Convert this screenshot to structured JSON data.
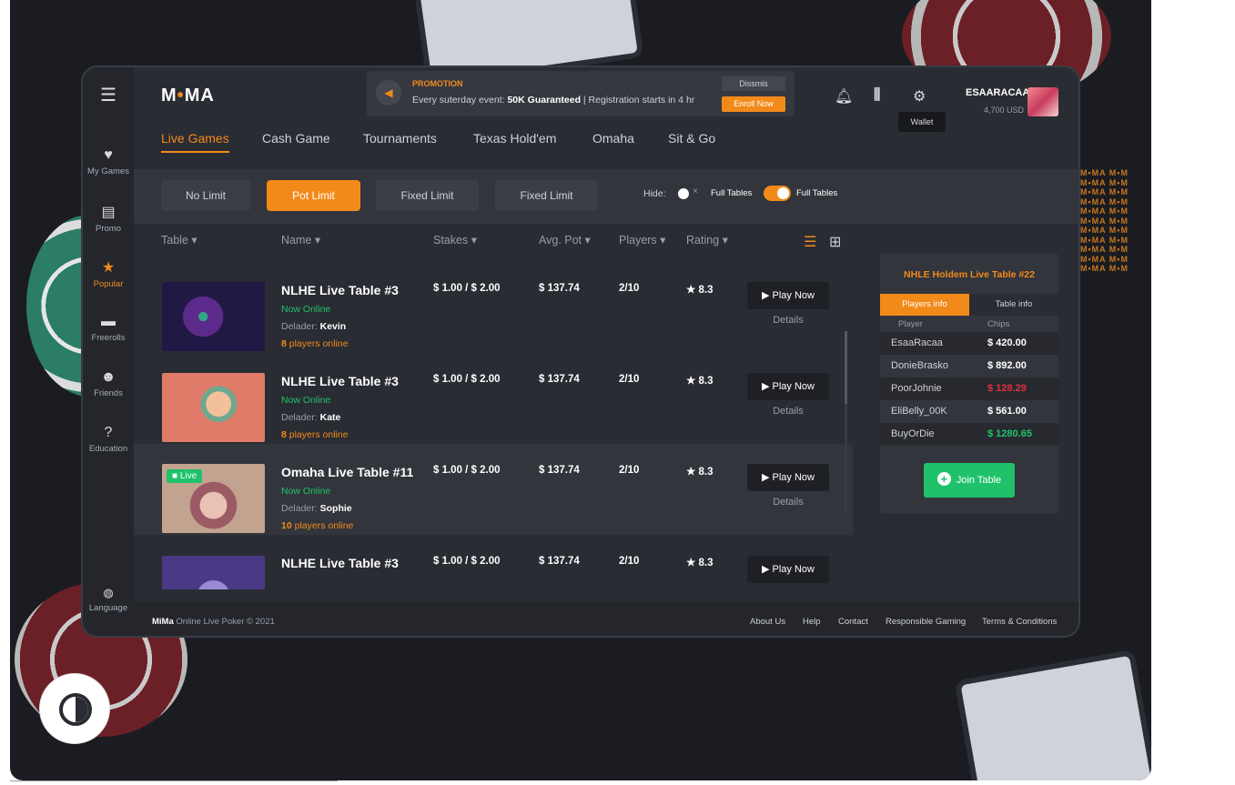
{
  "sidebar": {
    "items": [
      {
        "label": "My Games",
        "icon": "heart-icon",
        "glyph": "♥"
      },
      {
        "label": "Promo",
        "icon": "news-icon",
        "glyph": "▤"
      },
      {
        "label": "Popular",
        "icon": "star-icon",
        "glyph": "★"
      },
      {
        "label": "Freerolls",
        "icon": "briefcase-icon",
        "glyph": "▬"
      },
      {
        "label": "Friends",
        "icon": "friends-icon",
        "glyph": "☻"
      },
      {
        "label": "Education",
        "icon": "question-icon",
        "glyph": "?"
      },
      {
        "label": "Language",
        "icon": "globe-icon",
        "glyph": "◍"
      }
    ]
  },
  "header": {
    "logo_left": "M",
    "logo_dot": "•",
    "logo_right": "MA",
    "promo_title": "PROMOTION",
    "promo_text_pre": "Every suterday event: ",
    "promo_text_bold": "50K Guaranteed",
    "promo_text_post": " | Registration starts in 4 hr",
    "dismiss": "Dissmis",
    "enroll": "Enroll Now",
    "wallet_tooltip": "Wallet",
    "username": "ESAARACAA",
    "balance": "4,700 USD"
  },
  "tabs": [
    "Live Games",
    "Cash Game",
    "Tournaments",
    "Texas Hold'em",
    "Omaha",
    "Sit & Go"
  ],
  "filters": {
    "buttons": [
      "No Limit",
      "Pot Limit",
      "Fixed Limit",
      "Fixed Limit"
    ],
    "hide_label": "Hide:",
    "toggle_off_label": "Full Tables",
    "toggle_on_label": "Full Tables"
  },
  "columns": [
    "Table",
    "Name",
    "Stakes",
    "Avg. Pot",
    "Players",
    "Rating"
  ],
  "rows": [
    {
      "name": "NLHE Live Table #3",
      "status": "Now Online",
      "dealer_label": "Delader:",
      "dealer": "Kevin",
      "players_count": "8",
      "players_text": " players online",
      "stakes": "$ 1.00 / $ 2.00",
      "avg_pot": "$ 137.74",
      "players": "2/10",
      "rating": "8.3",
      "play": "Play Now",
      "details": "Details"
    },
    {
      "name": "NLHE Live Table #3",
      "status": "Now Online",
      "dealer_label": "Delader:",
      "dealer": "Kate",
      "players_count": "8",
      "players_text": " players online",
      "stakes": "$ 1.00 / $ 2.00",
      "avg_pot": "$ 137.74",
      "players": "2/10",
      "rating": "8.3",
      "play": "Play Now",
      "details": "Details"
    },
    {
      "name": "Omaha Live Table #11",
      "status": "Now Online",
      "dealer_label": "Delader:",
      "dealer": "Sophie",
      "players_count": "10",
      "players_text": " players online",
      "stakes": "$ 1.00 / $ 2.00",
      "avg_pot": "$ 137.74",
      "players": "2/10",
      "rating": "8.3",
      "play": "Play Now",
      "details": "Details",
      "live_badge": "Live"
    },
    {
      "name": "NLHE Live Table #3",
      "status": "",
      "dealer_label": "",
      "dealer": "",
      "players_count": "",
      "players_text": "",
      "stakes": "$ 1.00 / $ 2.00",
      "avg_pot": "$ 137.74",
      "players": "2/10",
      "rating": "8.3",
      "play": "Play Now",
      "details": ""
    }
  ],
  "panel": {
    "title": "NHLE Holdem Live Table #22",
    "tab_players": "Players info",
    "tab_table": "Table info",
    "col_player": "Player",
    "col_chips": "Chips",
    "players": [
      {
        "name": "EsaaRacaa",
        "chips": "$ 420.00",
        "color": "#ffffff"
      },
      {
        "name": "DonieBrasko",
        "chips": "$ 892.00",
        "color": "#ffffff"
      },
      {
        "name": "PoorJohnie",
        "chips": "$ 128.29",
        "color": "#e0313f"
      },
      {
        "name": "EliBelly_00K",
        "chips": "$ 561.00",
        "color": "#ffffff"
      },
      {
        "name": "BuyOrDie",
        "chips": "$ 1280.65",
        "color": "#1fc26a"
      }
    ],
    "join": "Join Table"
  },
  "footer": {
    "brand": "MiMa",
    "copy": " Online Live Poker © 2021",
    "links": [
      "About Us",
      "Help",
      "Contact",
      "Responsible Gaming",
      "Terms & Conditions"
    ]
  },
  "colors": {
    "accent": "#f28a1a",
    "online": "#1fc26a",
    "negative": "#e0313f",
    "background": "#1b1c21"
  }
}
